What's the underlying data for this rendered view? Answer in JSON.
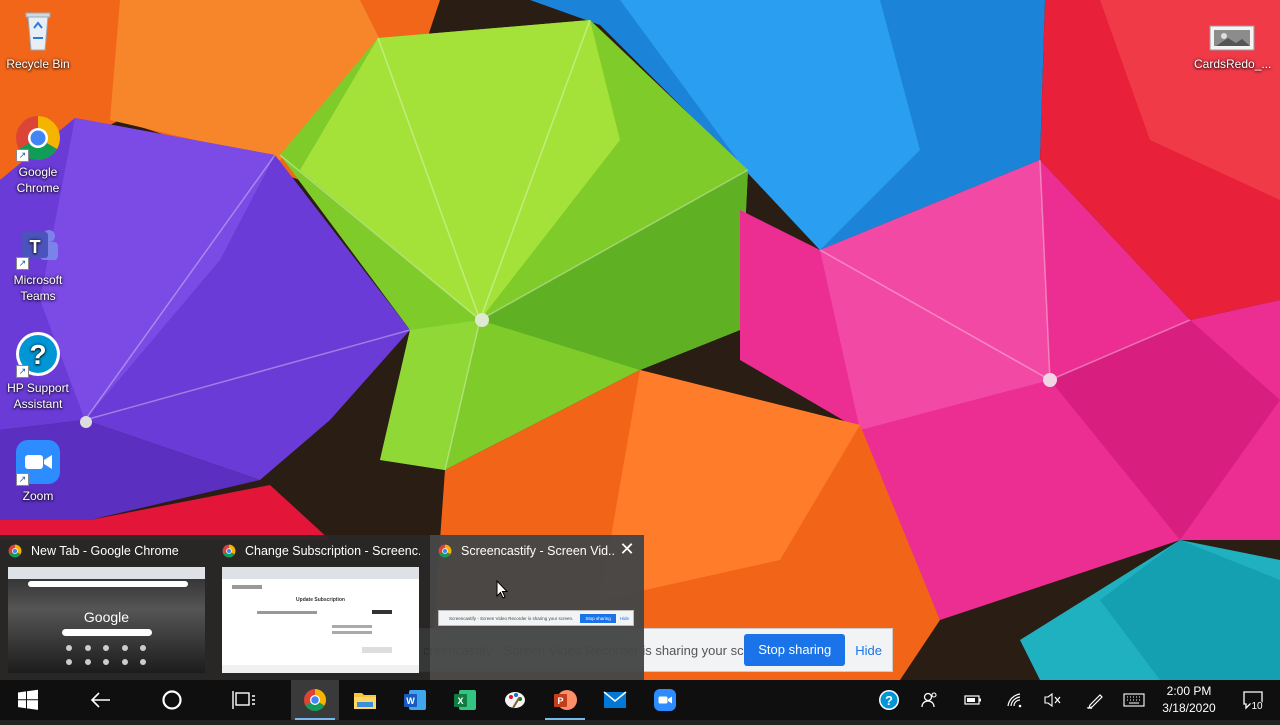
{
  "desktop": {
    "icons": [
      {
        "label": "Recycle Bin",
        "icon": "recycle-bin-icon"
      },
      {
        "label": "Google Chrome",
        "icon": "chrome-icon"
      },
      {
        "label": "Microsoft Teams",
        "icon": "teams-icon"
      },
      {
        "label": "HP Support Assistant",
        "icon": "hp-support-icon"
      },
      {
        "label": "Zoom",
        "icon": "zoom-icon"
      },
      {
        "label": "CardsRedo_...",
        "icon": "image-file-icon"
      }
    ]
  },
  "thumbnails": [
    {
      "title": "New Tab - Google Chrome",
      "preview_text": "Google"
    },
    {
      "title": "Change Subscription - Screenc...",
      "preview_text": "Update Subscription"
    },
    {
      "title": "Screencastify - Screen Vid...",
      "preview_text": "Screencastify - Screen Video Recorder is sharing your screen.",
      "preview_stop": "Stop sharing",
      "preview_hide": "Hide",
      "close_icon": "close-icon"
    }
  ],
  "share_bar": {
    "message": "creencastify - Screen Video Recorder is sharing your screen.",
    "stop_label": "Stop sharing",
    "hide_label": "Hide"
  },
  "taskbar": {
    "pinned": [
      "start-icon",
      "back-arrow-icon",
      "search-circle-icon",
      "task-view-icon",
      "chrome-icon",
      "file-explorer-icon",
      "word-icon",
      "excel-icon",
      "paint-icon",
      "powerpoint-icon",
      "mail-icon",
      "zoom-icon"
    ],
    "tray": [
      "help-icon",
      "people-icon",
      "battery-icon",
      "wifi-icon",
      "volume-muted-icon",
      "pen-icon",
      "keyboard-icon"
    ],
    "time": "2:00 PM",
    "date": "3/18/2020",
    "notification_count": "10"
  },
  "colors": {
    "accent": "#1a73e8",
    "taskbar": "#0f0f0f"
  }
}
